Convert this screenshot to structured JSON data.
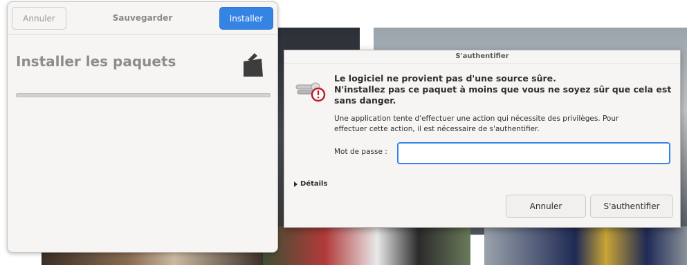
{
  "installer": {
    "cancel_label": "Annuler",
    "title": "Sauvegarder",
    "install_label": "Installer",
    "heading": "Installer les paquets",
    "icon": "package-icon"
  },
  "auth_dialog": {
    "title": "S'authentifier",
    "icon": "keys-warning-icon",
    "warning_lines": [
      "Le logiciel ne provient pas d'une source sûre.",
      "N'installez pas ce paquet à moins que vous ne soyez sûr que cela est",
      "sans danger."
    ],
    "info_lines": [
      "Une application tente d'effectuer une action qui nécessite des privilèges. Pour",
      "effectuer cette action, il est nécessaire de s'authentifier."
    ],
    "password_label": "Mot de passe :",
    "password_value": "",
    "details_label": "Détails",
    "cancel_label": "Annuler",
    "authenticate_label": "S'authentifier"
  },
  "colors": {
    "accent": "#3584e4",
    "warning": "#c01c28"
  }
}
